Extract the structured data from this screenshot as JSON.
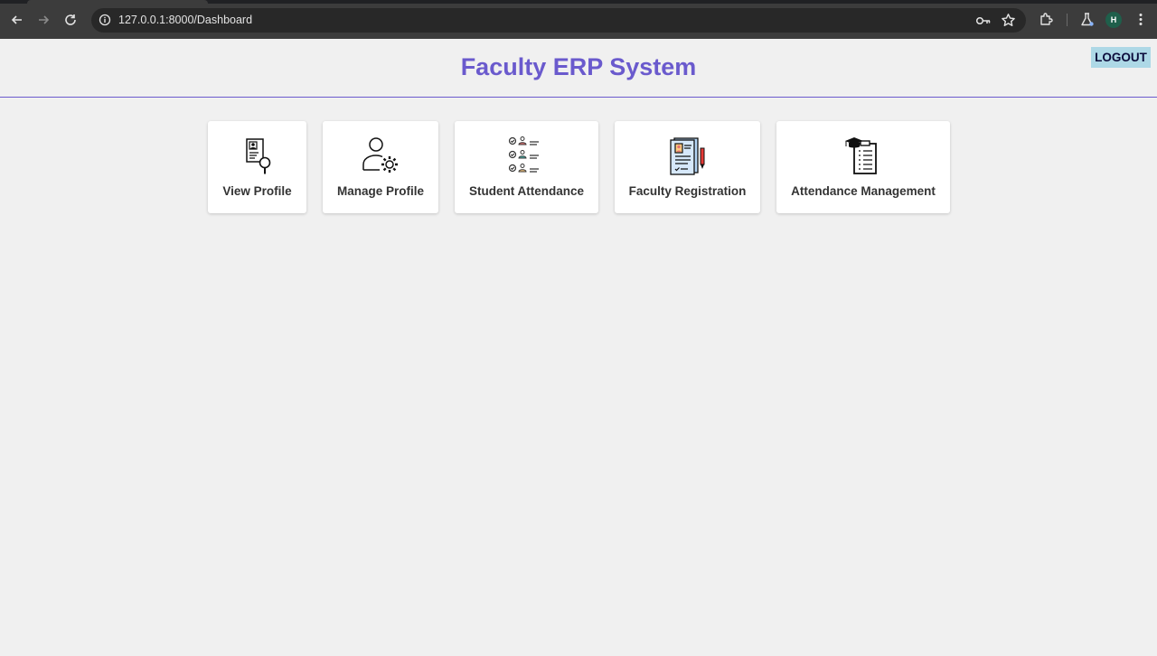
{
  "browser": {
    "url": "127.0.0.1:8000/Dashboard",
    "profile_initial": "H"
  },
  "header": {
    "title": "Faculty ERP System",
    "logout_label": "LOGOUT"
  },
  "cards": [
    {
      "label": "View Profile",
      "icon": "profile-search-icon"
    },
    {
      "label": "Manage Profile",
      "icon": "user-settings-icon"
    },
    {
      "label": "Student Attendance",
      "icon": "attendance-checklist-icon"
    },
    {
      "label": "Faculty Registration",
      "icon": "registration-form-icon"
    },
    {
      "label": "Attendance Management",
      "icon": "graduation-clipboard-icon"
    }
  ],
  "colors": {
    "accent": "#6a5acd",
    "logout_bg": "#add8e6",
    "page_bg": "#f0f0f0"
  }
}
